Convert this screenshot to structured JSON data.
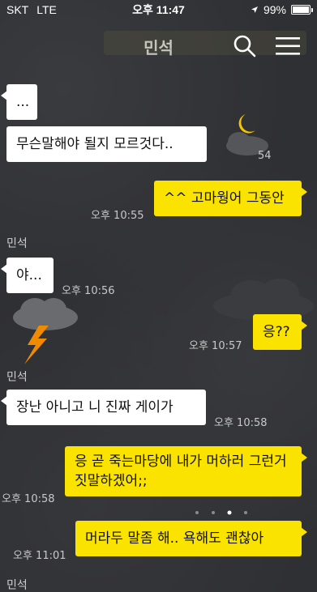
{
  "status_bar": {
    "carrier": "SKT",
    "network": "LTE",
    "time": "오후 11:47",
    "battery_percent": "99%",
    "battery_level": 0.99
  },
  "header": {
    "title": "민석",
    "search_icon": "search-icon",
    "menu_icon": "menu-icon"
  },
  "messages": [
    {
      "text": "...",
      "direction": "incoming"
    },
    {
      "text": "무슨말해야 될지 모르것다..",
      "direction": "incoming",
      "time": "54"
    },
    {
      "text": "^^ 고마웡어 그동안",
      "direction": "outgoing",
      "time": "오후 10:55"
    },
    {
      "sender": "민석",
      "text": "야...",
      "direction": "incoming",
      "time": "오후 10:56"
    },
    {
      "text": "응??",
      "direction": "outgoing",
      "time": "오후 10:57"
    },
    {
      "sender": "민석",
      "text": "장난 아니고 니 진짜 게이가",
      "direction": "incoming",
      "time": "오후 10:58"
    },
    {
      "text": "응 곧 죽는마당에 내가 머하러 그런거짓말하겠어;;",
      "direction": "outgoing",
      "time": "오후 10:58"
    },
    {
      "text": "머라두 말좀 해.. 욕해도 괜찮아",
      "direction": "outgoing",
      "time": "오후 11:01"
    },
    {
      "sender": "민석"
    }
  ],
  "colors": {
    "background": "#2f3033",
    "outgoing_bubble": "#fbe300",
    "incoming_bubble": "#ffffff"
  }
}
